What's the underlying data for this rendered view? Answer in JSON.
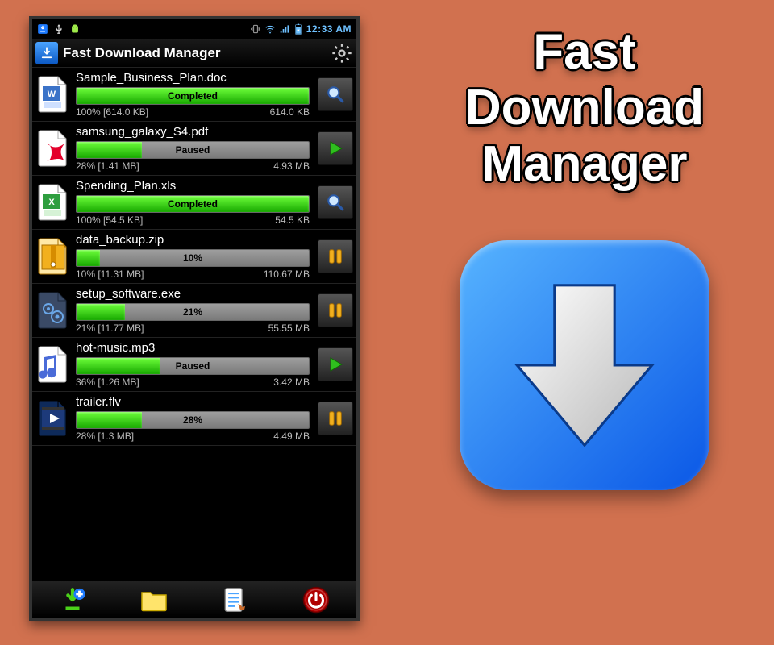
{
  "status_bar": {
    "time": "12:33 AM",
    "icons_left": [
      "download-icon",
      "usb-icon",
      "android-debug-icon"
    ],
    "icons_right": [
      "vibrate-icon",
      "wifi-icon",
      "cell-signal-icon",
      "battery-icon"
    ]
  },
  "app": {
    "title": "Fast Download Manager"
  },
  "downloads": [
    {
      "filename": "Sample_Business_Plan.doc",
      "file_icon": "doc-word-icon",
      "status_label": "Completed",
      "progress": 100,
      "left_info": "100% [614.0 KB]",
      "right_info": "614.0 KB",
      "action": "open"
    },
    {
      "filename": "samsung_galaxy_S4.pdf",
      "file_icon": "pdf-icon",
      "status_label": "Paused",
      "progress": 28,
      "left_info": "28% [1.41 MB]",
      "right_info": "4.93 MB",
      "action": "resume"
    },
    {
      "filename": "Spending_Plan.xls",
      "file_icon": "xls-icon",
      "status_label": "Completed",
      "progress": 100,
      "left_info": "100% [54.5 KB]",
      "right_info": "54.5 KB",
      "action": "open"
    },
    {
      "filename": "data_backup.zip",
      "file_icon": "zip-icon",
      "status_label": "10%",
      "progress": 10,
      "left_info": "10% [11.31 MB]",
      "right_info": "110.67 MB",
      "action": "pause"
    },
    {
      "filename": "setup_software.exe",
      "file_icon": "exe-icon",
      "status_label": "21%",
      "progress": 21,
      "left_info": "21% [11.77 MB]",
      "right_info": "55.55 MB",
      "action": "pause"
    },
    {
      "filename": "hot-music.mp3",
      "file_icon": "mp3-icon",
      "status_label": "Paused",
      "progress": 36,
      "left_info": "36% [1.26 MB]",
      "right_info": "3.42 MB",
      "action": "resume"
    },
    {
      "filename": "trailer.flv",
      "file_icon": "video-icon",
      "status_label": "28%",
      "progress": 28,
      "left_info": "28% [1.3 MB]",
      "right_info": "4.49 MB",
      "action": "pause"
    }
  ],
  "bottom_bar": {
    "buttons": [
      "add-download",
      "file-browser",
      "task-list",
      "power"
    ]
  },
  "promo": {
    "title_line1": "Fast",
    "title_line2": "Download",
    "title_line3": "Manager"
  }
}
